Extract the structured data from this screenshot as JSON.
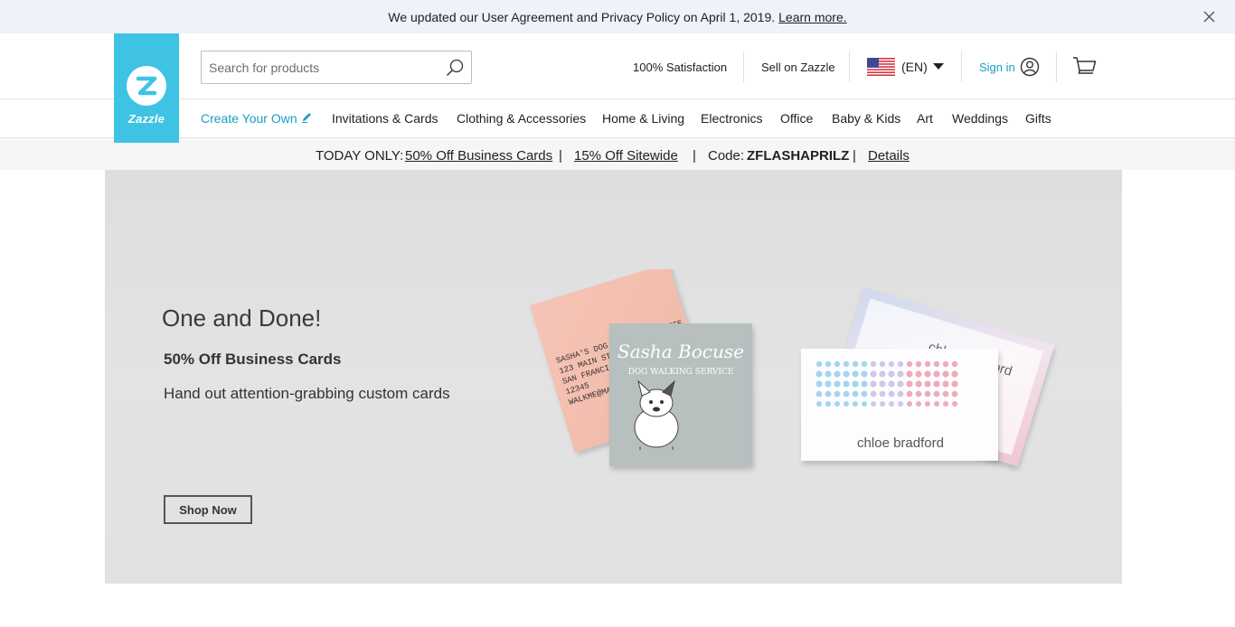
{
  "notice": {
    "text": "We updated our User Agreement and Privacy Policy on April 1, 2019.",
    "link": "Learn more."
  },
  "header": {
    "logo_text": "Zazzle",
    "search_placeholder": "Search for products",
    "satisfaction": "100% Satisfaction",
    "sell": "Sell on Zazzle",
    "language": "(EN)",
    "sign_in": "Sign in"
  },
  "nav": {
    "items": [
      "Create Your Own",
      "Invitations & Cards",
      "Clothing & Accessories",
      "Home & Living",
      "Electronics",
      "Office",
      "Baby & Kids",
      "Art",
      "Weddings",
      "Gifts"
    ]
  },
  "promo": {
    "prefix": "TODAY ONLY:",
    "offer1": "50% Off Business Cards",
    "sep": "|",
    "offer2": "15% Off Sitewide",
    "code_label": "Code:",
    "code": "ZFLASHAPRILZ",
    "details": "Details"
  },
  "hero": {
    "title": "One and Done!",
    "subtitle": "50% Off Business Cards",
    "description": "Hand out attention-grabbing custom cards",
    "button": "Shop Now",
    "card1_name": "Sasha Bocuse",
    "card1_service": "DOG WALKING SERVICE",
    "card1_back": [
      "SASHA'S DOG WALKING SERVICE",
      "123 MAIN STREET",
      "SAN FRANCISCO",
      "12345",
      "WALKME@MAIL"
    ],
    "card2_name": "chloe bradford"
  },
  "colors": {
    "brand": "#3ec3e4",
    "link": "#1a9ec7",
    "notice_bg": "#eef2fa"
  }
}
